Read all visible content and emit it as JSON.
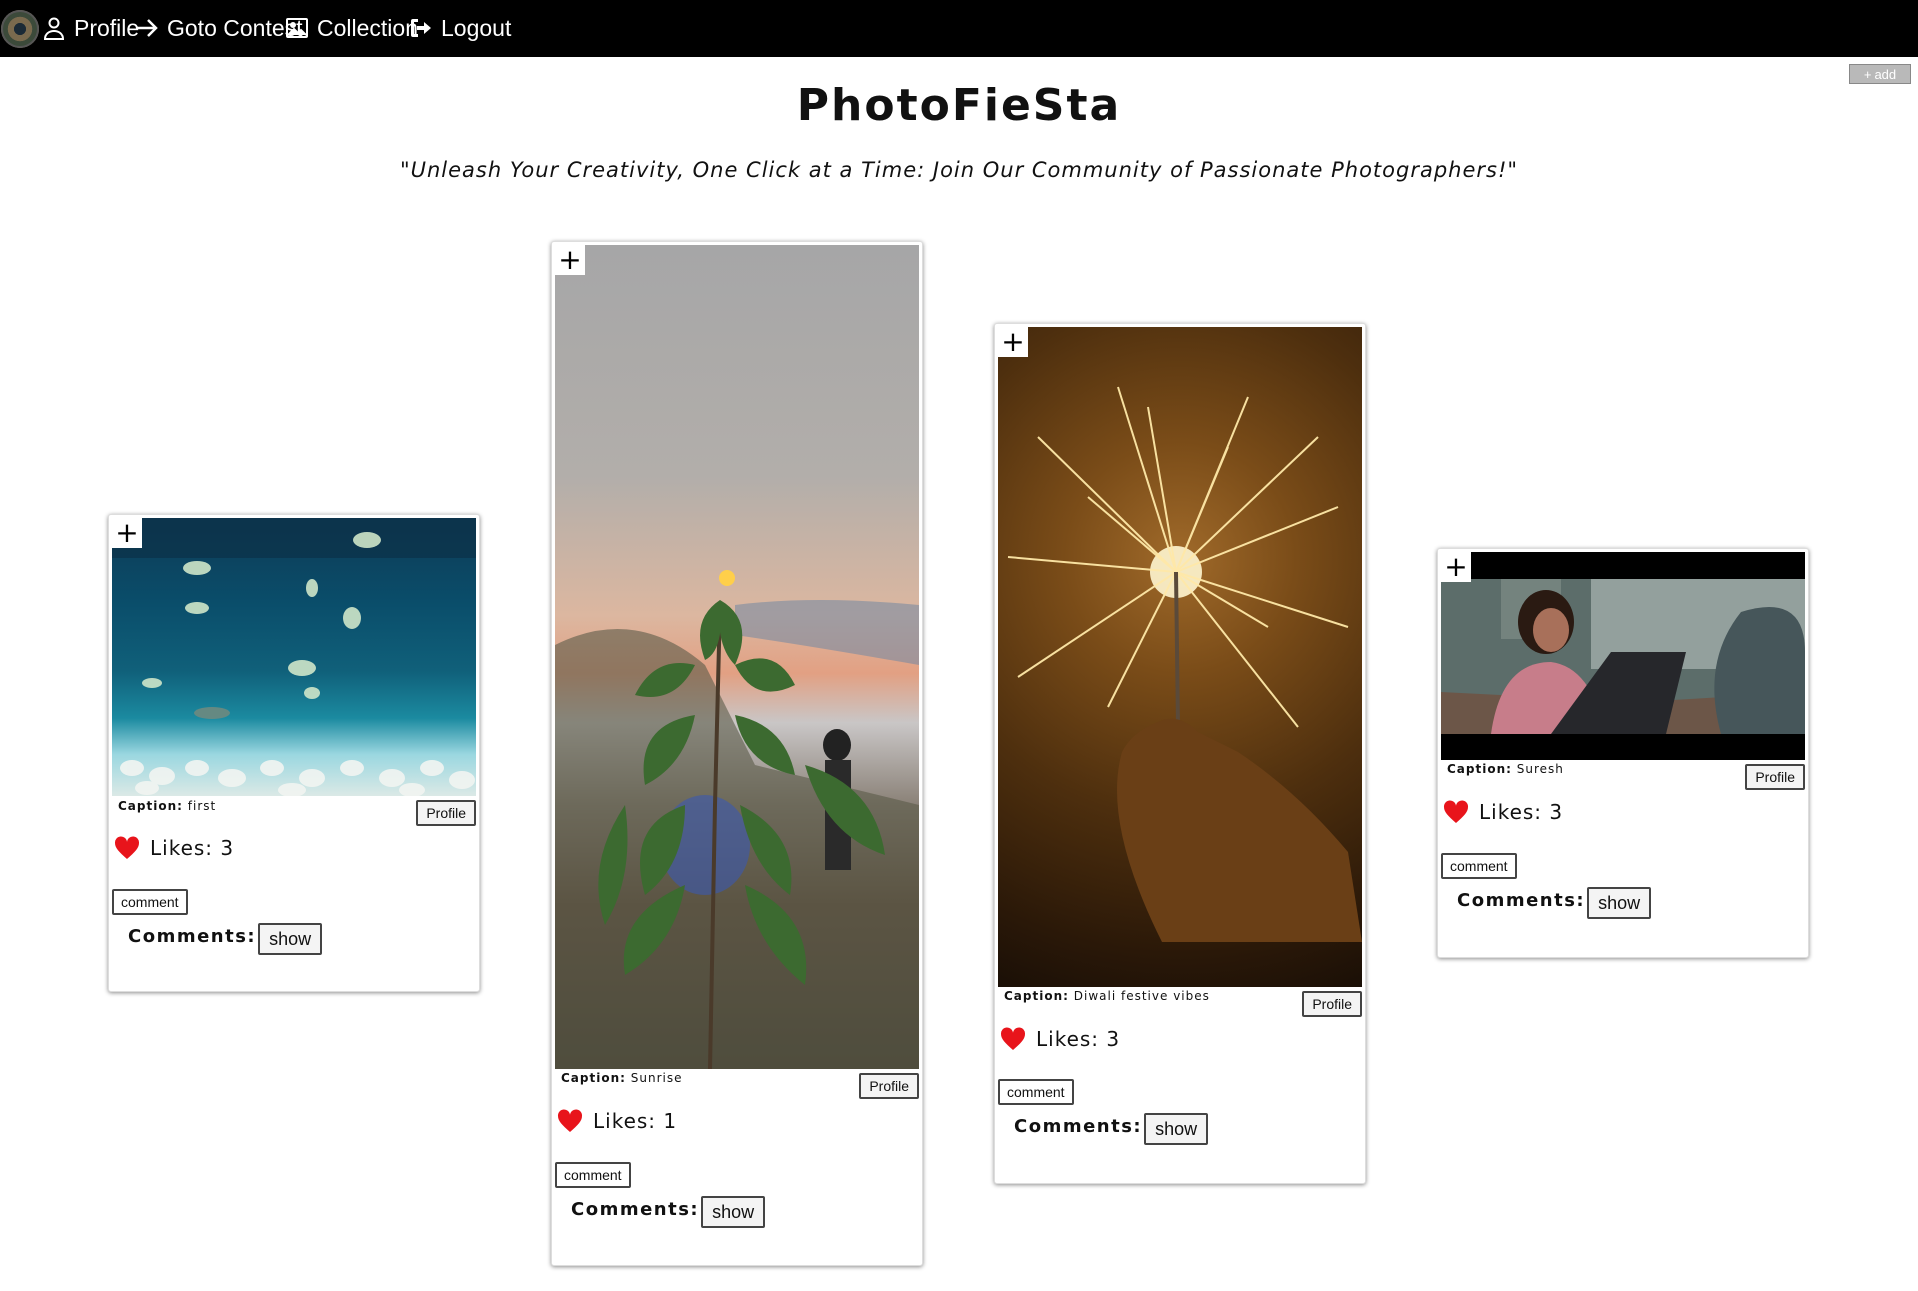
{
  "nav": {
    "items": [
      {
        "label": "Profile",
        "icon": "user-icon"
      },
      {
        "label": "Goto Contest",
        "icon": "arrow-right-icon"
      },
      {
        "label": "Collection",
        "icon": "image-icon"
      },
      {
        "label": "Logout",
        "icon": "logout-icon"
      }
    ]
  },
  "add_button": {
    "label": "add",
    "icon": "plus-icon"
  },
  "title": "PhotoFieSta",
  "tagline": "\"Unleash Your Creativity, One Click at a Time: Join Our Community of Passionate Photographers!\"",
  "labels": {
    "caption": "Caption:",
    "profile": "Profile",
    "likes_prefix": "Likes:",
    "comment": "comment",
    "comments": "Comments:",
    "show": "show",
    "add_to_collection": "+"
  },
  "posts": [
    {
      "caption": "first",
      "likes": "3",
      "photo": "aquarium-fish"
    },
    {
      "caption": "Sunrise",
      "likes": "1",
      "photo": "sunrise-plant"
    },
    {
      "caption": "Diwali festive vibes",
      "likes": "3",
      "photo": "sparkler"
    },
    {
      "caption": "Suresh",
      "likes": "3",
      "photo": "woman-laptop"
    }
  ],
  "colors": {
    "nav_bg": "#000000",
    "heart": "#e8141b",
    "add_button": "#b9b9b9"
  }
}
